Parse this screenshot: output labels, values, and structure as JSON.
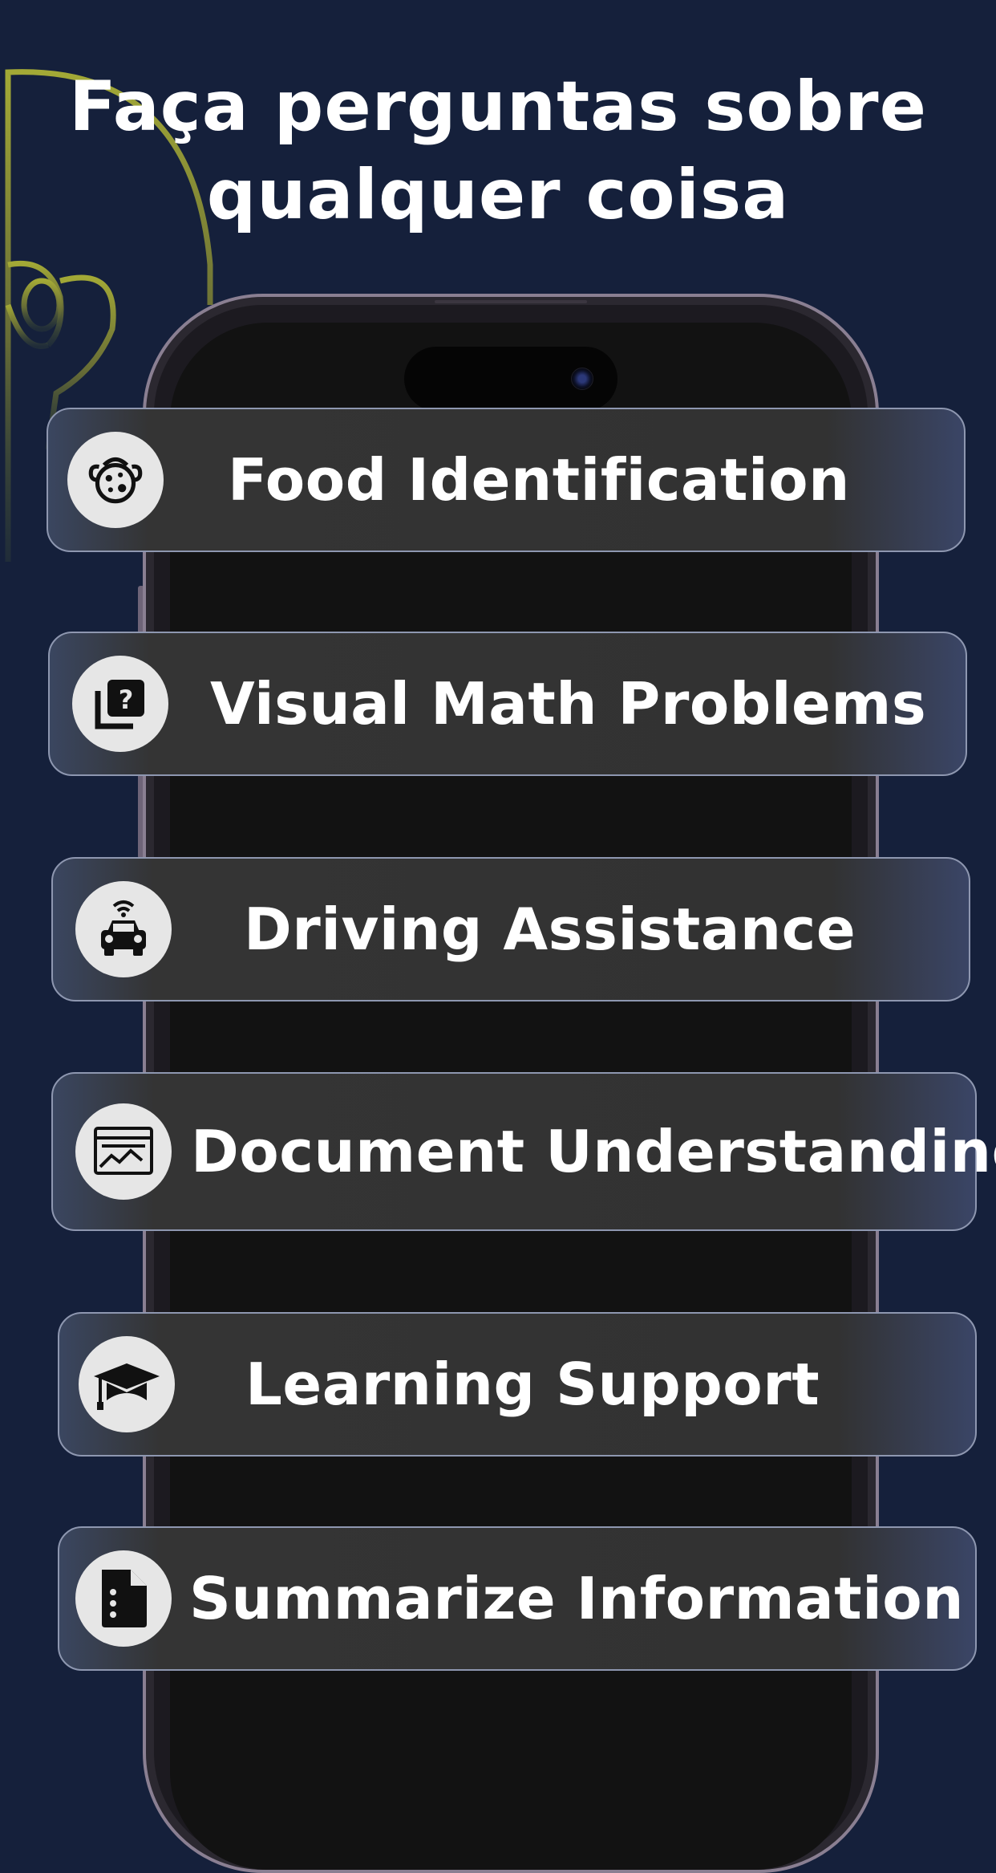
{
  "header": {
    "title_line1": "Faça perguntas sobre",
    "title_line2": "qualquer coisa"
  },
  "features": [
    {
      "label": "Food Identification",
      "icon": "food-icon"
    },
    {
      "label": "Visual Math Problems",
      "icon": "question-box-icon"
    },
    {
      "label": "Driving Assistance",
      "icon": "car-icon"
    },
    {
      "label": "Document Understanding",
      "icon": "document-chart-icon"
    },
    {
      "label": "Learning Support",
      "icon": "graduation-cap-icon"
    },
    {
      "label": "Summarize Information",
      "icon": "file-icon"
    }
  ],
  "colors": {
    "background": "#15203b",
    "accent_line": "#8e9434",
    "card": "#333333",
    "text": "#ffffff"
  }
}
